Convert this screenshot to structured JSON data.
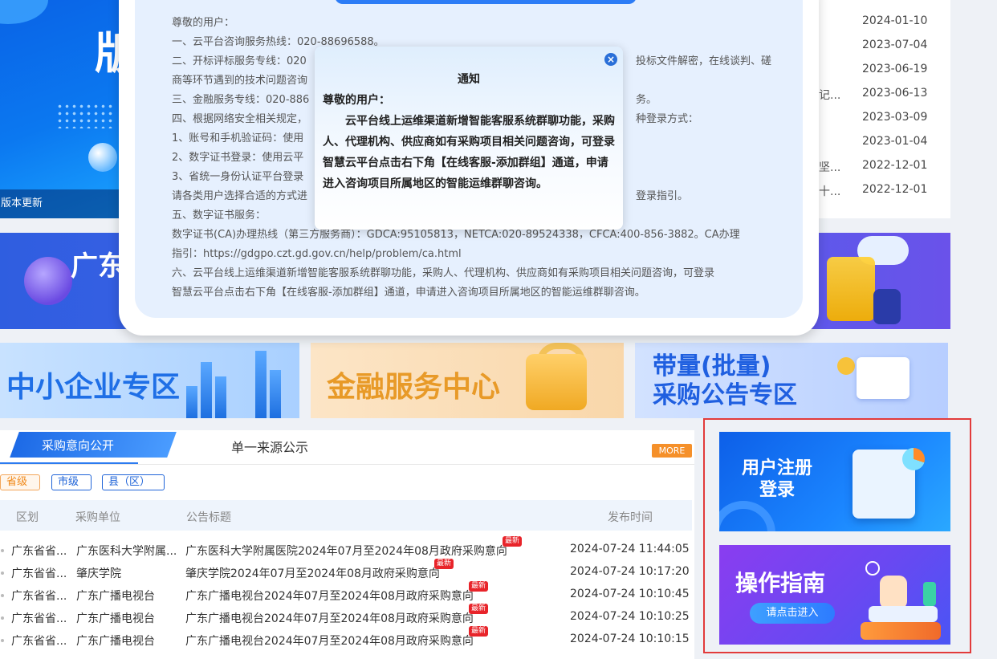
{
  "hero": {
    "big_text": "版",
    "caption": "版本更新"
  },
  "news_list": [
    {
      "frag": "",
      "date": "2024-01-10"
    },
    {
      "frag": "",
      "date": "2023-07-04"
    },
    {
      "frag": "",
      "date": "2023-06-19"
    },
    {
      "frag": "记...",
      "date": "2023-06-13"
    },
    {
      "frag": "",
      "date": "2023-03-09"
    },
    {
      "frag": "",
      "date": "2023-01-04"
    },
    {
      "frag": "坚...",
      "date": "2022-12-01"
    },
    {
      "frag": "十...",
      "date": "2022-12-01"
    }
  ],
  "banner": {
    "text": "广东"
  },
  "tiles": {
    "sme": "中小企业专区",
    "finance": "金融服务中心",
    "bulk_line1": "带量(批量)",
    "bulk_line2": "采购公告专区"
  },
  "panel": {
    "tab_active": "采购意向公开",
    "tab_other": "单一来源公示",
    "more": "MORE",
    "filters": [
      "省级",
      "市级",
      "县（区）"
    ],
    "headers": {
      "region": "区划",
      "unit": "采购单位",
      "title": "公告标题",
      "time": "发布时间"
    },
    "badge": "最新",
    "rows": [
      {
        "region": "广东省省...",
        "unit": "广东医科大学附属...",
        "title": "广东医科大学附属医院2024年07月至2024年08月政府采购意向",
        "time": "2024-07-24 11:44:05"
      },
      {
        "region": "广东省省...",
        "unit": "肇庆学院",
        "title": "肇庆学院2024年07月至2024年08月政府采购意向",
        "time": "2024-07-24 10:17:20"
      },
      {
        "region": "广东省省...",
        "unit": "广东广播电视台",
        "title": "广东广播电视台2024年07月至2024年08月政府采购意向",
        "time": "2024-07-24 10:10:45"
      },
      {
        "region": "广东省省...",
        "unit": "广东广播电视台",
        "title": "广东广播电视台2024年07月至2024年08月政府采购意向",
        "time": "2024-07-24 10:10:25"
      },
      {
        "region": "广东省省...",
        "unit": "广东广播电视台",
        "title": "广东广播电视台2024年07月至2024年08月政府采购意向",
        "time": "2024-07-24 10:10:15"
      }
    ]
  },
  "side_cards": {
    "register_line1": "用户注册",
    "register_line2": "登录",
    "guide_title": "操作指南",
    "guide_button": "请点击进入"
  },
  "modal_lines": [
    "尊敬的用户：",
    "一、云平台咨询服务热线：020-88696588。",
    "二、开标评标服务专线：020",
    "商等环节遇到的技术问题咨询",
    "三、金融服务专线：020-886",
    "四、根据网络安全相关规定，",
    "1、账号和手机验证码：使用",
    "2、数字证书登录：使用云平",
    "3、省统一身份认证平台登录",
    "请各类用户选择合适的方式进",
    "五、数字证书服务：",
    "数字证书(CA)办理热线（第三方服务商）：GDCA:95105813，NETCA:020-89524338，CFCA:400-856-3882。CA办理",
    "指引：https://gdgpo.czt.gd.gov.cn/help/problem/ca.html",
    "六、云平台线上运维渠道新增智能客服系统群聊功能，采购人、代理机构、供应商如有采购项目相关问题咨询，可登录",
    "智慧云平台点击右下角【在线客服-添加群组】通道，申请进入咨询项目所属地区的智能运维群聊咨询。"
  ],
  "modal_right_frags": {
    "line2": "投标文件解密，在线谈判、磋",
    "line4": "务。",
    "line5": "种登录方式：",
    "line9": "登录指引。"
  },
  "notice": {
    "close": "×",
    "title": "通知",
    "greeting": "尊敬的用户：",
    "body": "　　云平台线上运维渠道新增智能客服系统群聊功能，采购人、代理机构、供应商如有采购项目相关问题咨询，可登录智慧云平台点击右下角【在线客服-添加群组】通道，申请进入咨询项目所属地区的智能运维群聊咨询。"
  },
  "colors": {
    "accent": "#1f64d8",
    "highlight_box": "#e23b3b",
    "more_badge": "#f5902a",
    "new_badge": "#e8242a"
  }
}
